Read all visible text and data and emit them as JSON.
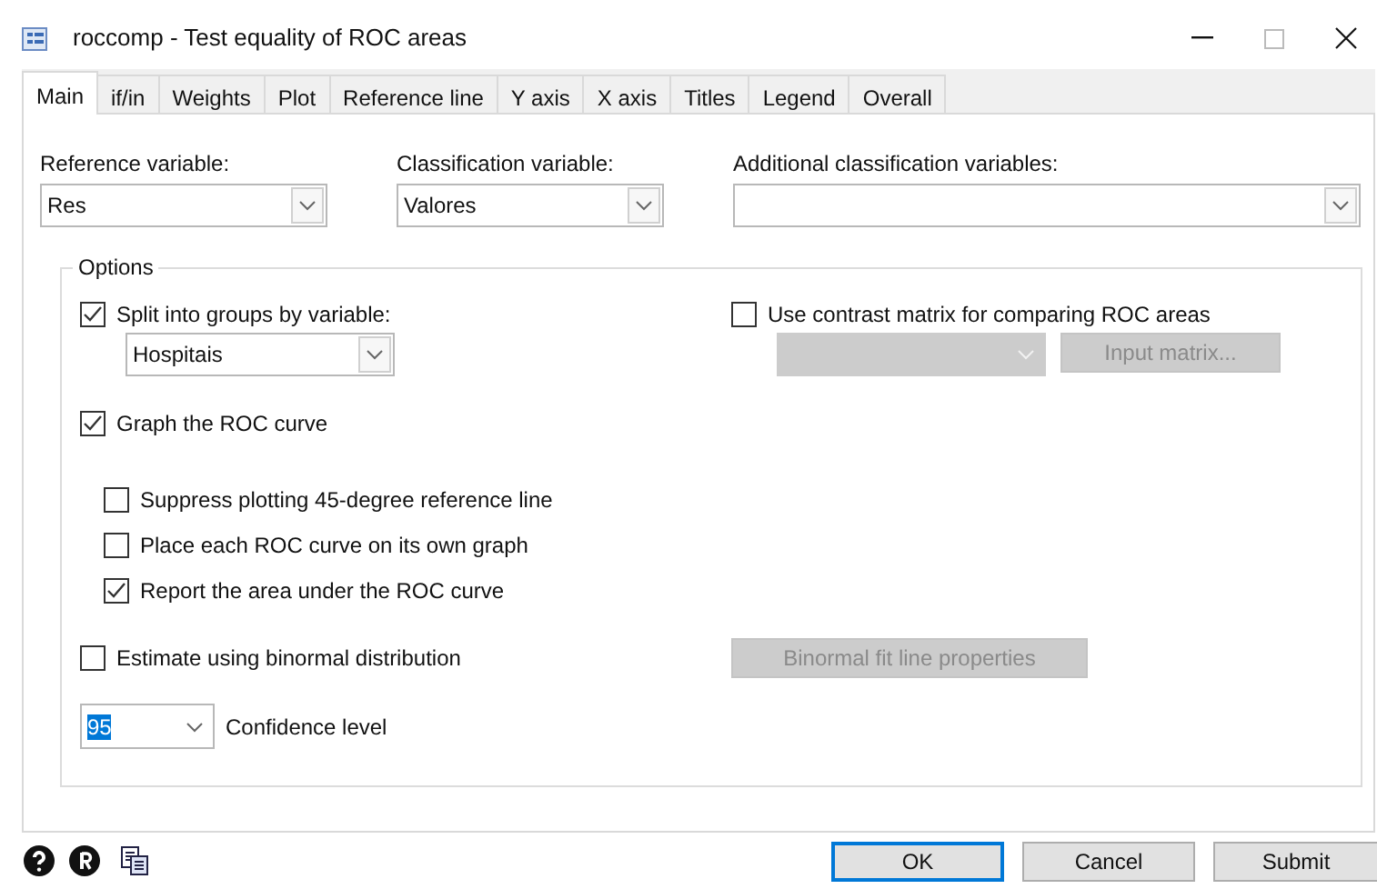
{
  "window": {
    "title": "roccomp - Test equality of ROC areas"
  },
  "tabs": [
    {
      "label": "Main",
      "selected": true
    },
    {
      "label": "if/in",
      "selected": false
    },
    {
      "label": "Weights",
      "selected": false
    },
    {
      "label": "Plot",
      "selected": false
    },
    {
      "label": "Reference line",
      "selected": false
    },
    {
      "label": "Y axis",
      "selected": false
    },
    {
      "label": "X axis",
      "selected": false
    },
    {
      "label": "Titles",
      "selected": false
    },
    {
      "label": "Legend",
      "selected": false
    },
    {
      "label": "Overall",
      "selected": false
    }
  ],
  "variables": [
    {
      "label": "Reference variable:",
      "value": "Res"
    },
    {
      "label": "Classification variable:",
      "value": "Valores"
    },
    {
      "label": "Additional classification variables:"
    }
  ],
  "options": {
    "title": "Options",
    "split": {
      "label": "Split into groups by variable:",
      "checked": true,
      "value": "Hospitais"
    },
    "contrast": {
      "label": "Use contrast matrix for comparing ROC areas",
      "checked": false,
      "disabled": true,
      "button": "Input matrix..."
    },
    "graph": {
      "label": "Graph the ROC curve",
      "checked": true,
      "children": [
        {
          "label": "Suppress plotting 45-degree reference line",
          "checked": false
        },
        {
          "label": "Place each ROC curve on its own graph",
          "checked": false
        },
        {
          "label": "Report the area under the ROC curve",
          "checked": true
        }
      ]
    },
    "binormal": {
      "label": "Estimate using binormal distribution",
      "checked": false,
      "button": "Binormal fit line properties",
      "disabled": true
    },
    "confidence": {
      "value": "95",
      "highlighted": true,
      "label": "Confidence level"
    }
  },
  "buttons": [
    {
      "label": "OK",
      "default": true
    },
    {
      "label": "Cancel",
      "default": false
    },
    {
      "label": "Submit",
      "default": false
    }
  ]
}
